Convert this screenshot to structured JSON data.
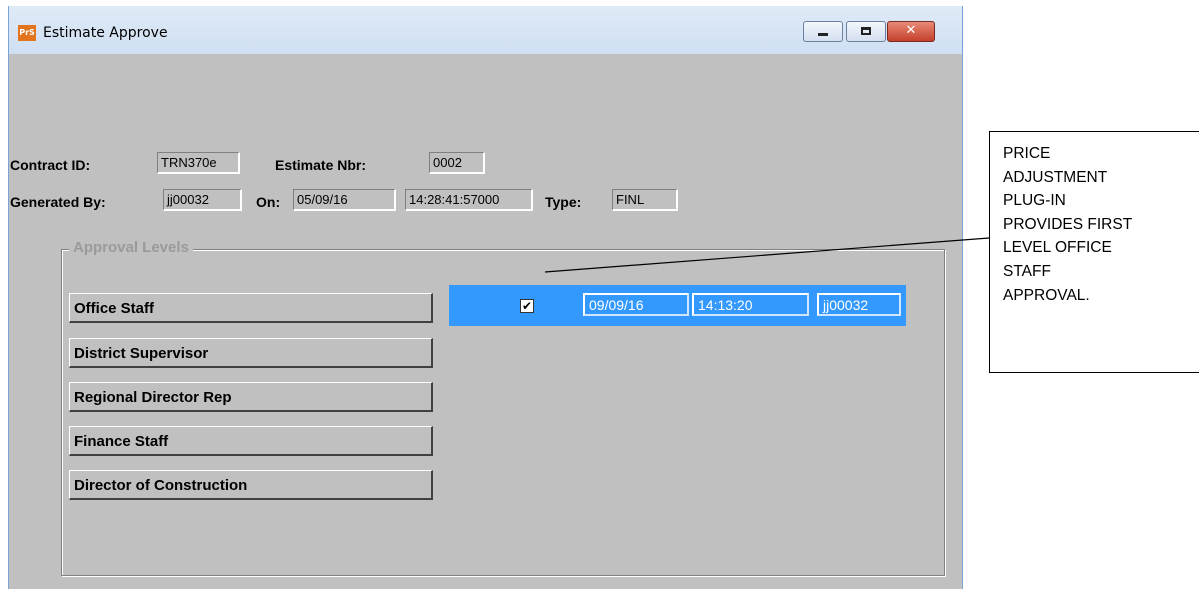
{
  "window": {
    "title": "Estimate Approve",
    "icon_label": "PrS",
    "controls": {
      "minimize": "minimize-icon",
      "maximize": "maximize-icon",
      "close": "close-icon",
      "close_glyph": "✕"
    }
  },
  "header": {
    "contract_id_label": "Contract ID:",
    "contract_id": "TRN370e",
    "estimate_nbr_label": "Estimate Nbr:",
    "estimate_nbr": "0002",
    "generated_by_label": "Generated By:",
    "generated_by": "jj00032",
    "on_label": "On:",
    "on_date": "05/09/16",
    "on_time": "14:28:41:57000",
    "type_label": "Type:",
    "type": "FINL"
  },
  "approval_levels": {
    "legend": "Approval Levels",
    "levels": [
      {
        "label": "Office Staff"
      },
      {
        "label": "District Supervisor"
      },
      {
        "label": "Regional Director Rep"
      },
      {
        "label": "Finance Staff"
      },
      {
        "label": "Director of Construction"
      }
    ],
    "selected_row": {
      "checked_glyph": "✔",
      "date": "09/09/16",
      "time": "14:13:20",
      "user": "jj00032"
    }
  },
  "callout": {
    "lines": [
      "PRICE",
      "ADJUSTMENT",
      "PLUG-IN",
      "PROVIDES FIRST",
      "LEVEL OFFICE",
      "STAFF",
      "APPROVAL."
    ]
  },
  "colors": {
    "window_bg": "#c0c0c0",
    "selection": "#3399ff",
    "titlebar": "#dfeaf7"
  }
}
